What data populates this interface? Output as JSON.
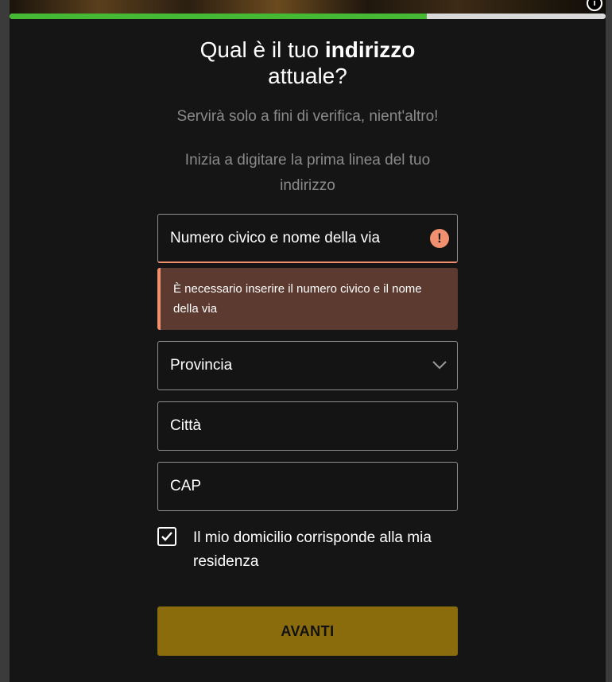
{
  "progress": {
    "value_percent": 70,
    "fill_color": "#45b834",
    "track_color": "#d9d9d9"
  },
  "header": {
    "info_icon": "info-icon",
    "title_prefix": "Qual è il tuo ",
    "title_bold": "indirizzo",
    "title_suffix": "attuale?",
    "subtitle": "Servirà solo a fini di verifica, nient'altro!",
    "hint": "Inizia a digitare la prima linea del tuo indirizzo"
  },
  "form": {
    "street": {
      "placeholder": "Numero civico e nome della via",
      "value": "",
      "status_icon": "warning-icon"
    },
    "street_error": "È necessario inserire il numero civico e il nome della via",
    "province": {
      "label": "Provincia",
      "icon": "chevron-down-icon"
    },
    "city": {
      "placeholder": "Città",
      "value": ""
    },
    "zip": {
      "placeholder": "CAP",
      "value": ""
    },
    "residence_checkbox": {
      "label": "Il mio domicilio corrisponde alla mia residenza",
      "checked": true
    },
    "submit_label": "AVANTI"
  },
  "colors": {
    "background": "#151515",
    "error_accent": "#f0906e",
    "error_bg": "#5c3a2f",
    "button": "#8a6c0c"
  }
}
